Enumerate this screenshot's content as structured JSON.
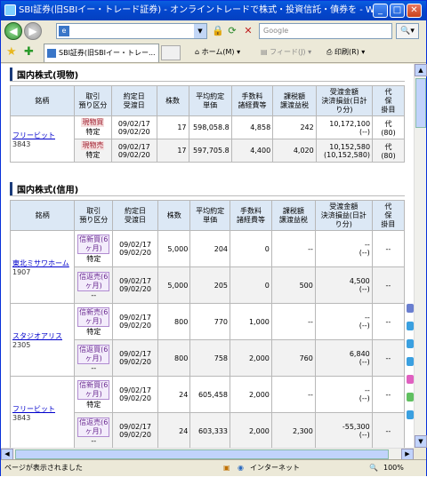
{
  "window": {
    "title": "SBI証券(旧SBIイー・トレード証券) - オンライントレードで株式・投資信託・債券を - Wi...",
    "min": "_",
    "max": "□",
    "close": "✕"
  },
  "nav": {
    "address": "e",
    "search_placeholder": "Google",
    "search_btn": "🔍▾"
  },
  "tabs": {
    "active": "SBI証券(旧SBIイー・トレー...",
    "home": "ホーム(M)",
    "feed": "フィード(J)",
    "print": "印刷(R)"
  },
  "sections": {
    "genbutsu": {
      "title": "国内株式(現物)",
      "headers": [
        "銘柄",
        "取引/預り区分",
        "約定日/受渡日",
        "株数",
        "平均約定/単価",
        "手数料/諸経費等",
        "課税額/譲渡益税",
        "受渡金額/決済損益(日計り分)",
        "代/保/掛目"
      ],
      "rows": [
        {
          "name": "フリービット",
          "code": "3843",
          "trade1": "現物買",
          "kubun1": "特定",
          "dates1": [
            "09/02/17",
            "09/02/20"
          ],
          "qty1": "17",
          "price1": "598,058.8",
          "fee1": "4,858",
          "tax1": "242",
          "amt1": [
            "10,172,100",
            "(--)"
          ],
          "dai1": [
            "代",
            "(80)"
          ],
          "trade2": "現物売",
          "kubun2": "特定",
          "dates2": [
            "09/02/17",
            "09/02/20"
          ],
          "qty2": "17",
          "price2": "597,705.8",
          "fee2": "4,400",
          "tax2": "4,020",
          "amt2": [
            "10,152,580",
            "(10,152,580)"
          ],
          "dai2": [
            "代",
            "(80)"
          ]
        }
      ]
    },
    "shinyo": {
      "title": "国内株式(信用)",
      "headers": [
        "銘柄",
        "取引/預り区分",
        "約定日/受渡日",
        "株数",
        "平均約定/単価",
        "手数料/諸経費等",
        "課税額/譲渡益税",
        "受渡金額/決済損益(日計り分)",
        "代/保/掛目"
      ],
      "rows": [
        {
          "name": "東北ミサワホーム",
          "code": "1907",
          "t1": [
            "信新買(6",
            "ヶ月)",
            "特定"
          ],
          "d1": [
            "09/02/17",
            "09/02/20"
          ],
          "q1": "5,000",
          "p1": "204",
          "f1": "0",
          "x1": "--",
          "a1": [
            "--",
            "(--)"
          ],
          "k1": "--",
          "t2": [
            "信返売(6",
            "ヶ月)",
            "--"
          ],
          "d2": [
            "09/02/17",
            "09/02/20"
          ],
          "q2": "5,000",
          "p2": "205",
          "f2": "0",
          "x2": "500",
          "a2": [
            "4,500",
            "(--)"
          ],
          "k2": "--"
        },
        {
          "name": "スタジオアリス",
          "code": "2305",
          "t1": [
            "信新売(6",
            "ヶ月)",
            "特定"
          ],
          "d1": [
            "09/02/17",
            "09/02/20"
          ],
          "q1": "800",
          "p1": "770",
          "f1": "1,000",
          "x1": "--",
          "a1": [
            "--",
            "(--)"
          ],
          "k1": "--",
          "t2": [
            "信返買(6",
            "ヶ月)",
            "--"
          ],
          "d2": [
            "09/02/17",
            "09/02/20"
          ],
          "q2": "800",
          "p2": "758",
          "f2": "2,000",
          "x2": "760",
          "a2": [
            "6,840",
            "(--)"
          ],
          "k2": "--"
        },
        {
          "name": "フリービット",
          "code": "3843",
          "t1": [
            "信新買(6",
            "ヶ月)",
            "特定"
          ],
          "d1": [
            "09/02/17",
            "09/02/20"
          ],
          "q1": "24",
          "p1": "605,458",
          "f1": "2,000",
          "x1": "--",
          "a1": [
            "--",
            "(--)"
          ],
          "k1": "--",
          "t2": [
            "信返売(6",
            "ヶ月)",
            "--"
          ],
          "d2": [
            "09/02/17",
            "09/02/20"
          ],
          "q2": "24",
          "p2": "603,333",
          "f2": "2,000",
          "x2": "2,300",
          "a2": [
            "-55,300",
            "(--)"
          ],
          "k2": "--"
        }
      ]
    }
  },
  "status": {
    "left": "ページが表示されました",
    "zone": "インターネット",
    "zoom": "100%"
  }
}
